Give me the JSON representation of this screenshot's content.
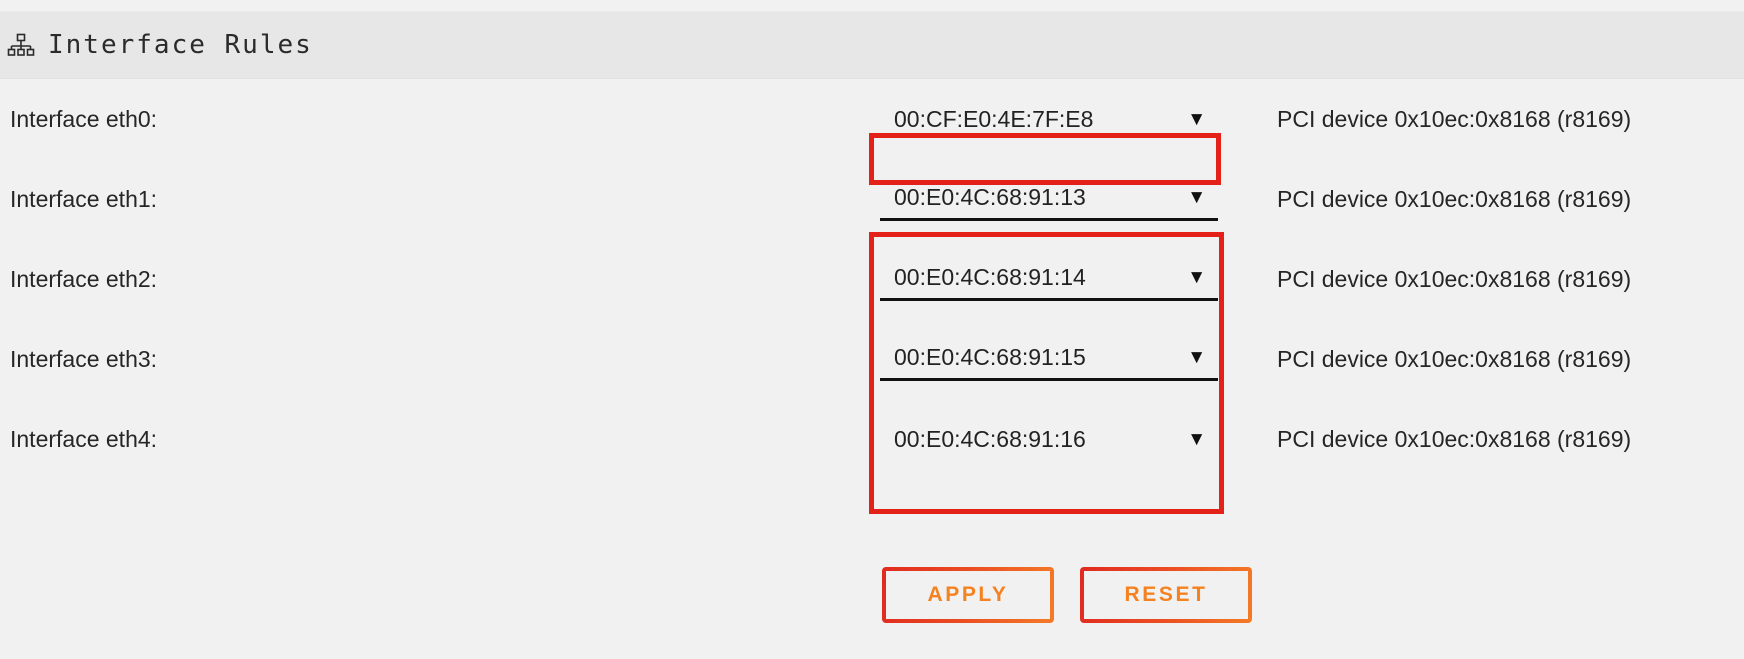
{
  "header": {
    "icon": "sitemap-icon",
    "title": "Interface Rules"
  },
  "rows": [
    {
      "label": "Interface eth0:",
      "mac": "00:CF:E0:4E:7F:E8",
      "arrow": "▼",
      "note": "PCI device 0x10ec:0x8168 (r8169)"
    },
    {
      "label": "Interface eth1:",
      "mac": "00:E0:4C:68:91:13",
      "arrow": "▼",
      "note": "PCI device 0x10ec:0x8168 (r8169)"
    },
    {
      "label": "Interface eth2:",
      "mac": "00:E0:4C:68:91:14",
      "arrow": "▼",
      "note": "PCI device 0x10ec:0x8168 (r8169)"
    },
    {
      "label": "Interface eth3:",
      "mac": "00:E0:4C:68:91:15",
      "arrow": "▼",
      "note": "PCI device 0x10ec:0x8168 (r8169)"
    },
    {
      "label": "Interface eth4:",
      "mac": "00:E0:4C:68:91:16",
      "arrow": "▼",
      "note": "PCI device 0x10ec:0x8168 (r8169)"
    }
  ],
  "actions": {
    "apply_label": "APPLY",
    "reset_label": "RESET"
  },
  "colors": {
    "page_background": "#f1f1f1",
    "header_background": "#e7e7e7",
    "highlight_border": "#e32119",
    "button_text": "#f58220",
    "button_border_start": "#e02a20",
    "button_border_end": "#f47b27",
    "text": "#262626"
  }
}
